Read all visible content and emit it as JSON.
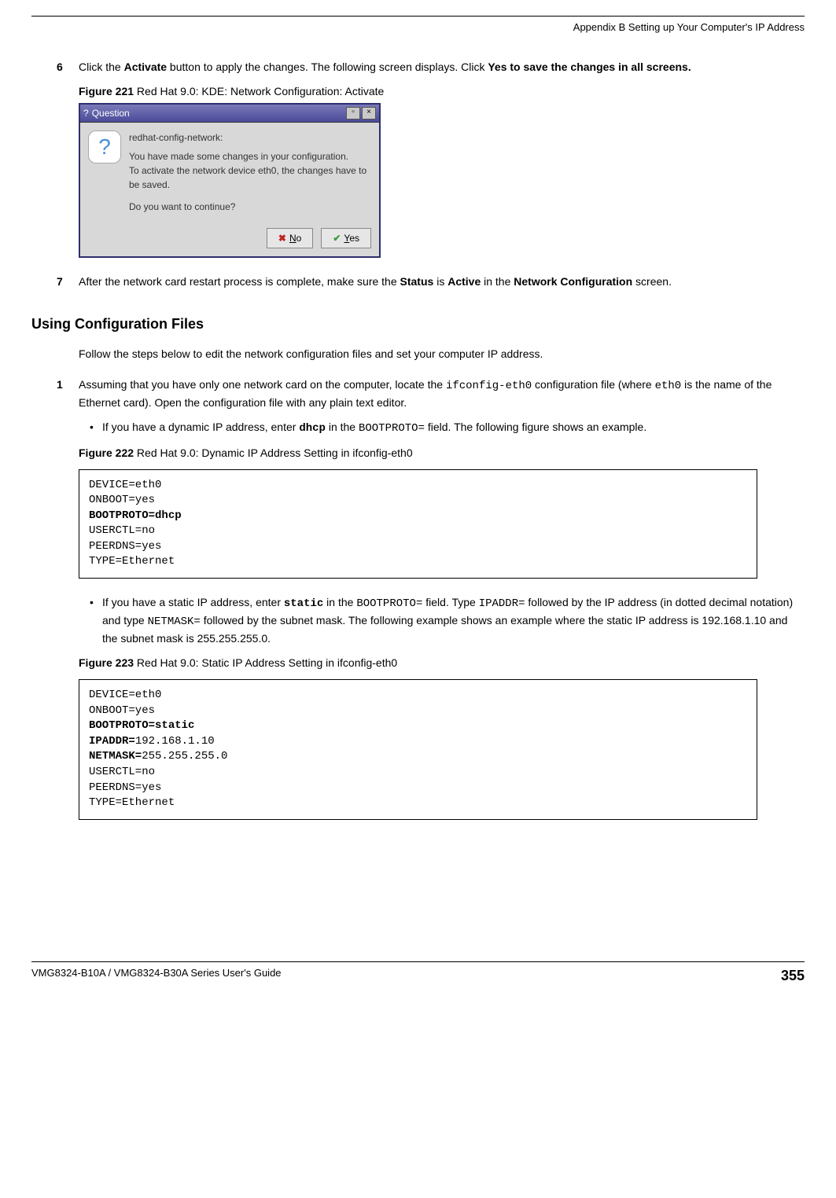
{
  "header": {
    "running_head": "Appendix B Setting up Your Computer's IP Address"
  },
  "step6": {
    "num": "6",
    "text_a": "Click the ",
    "text_bold1": "Activate",
    "text_b": " button to apply the changes. The following screen displays. Click ",
    "text_bold2": "Yes to save the changes in all screens."
  },
  "fig221": {
    "label": "Figure 221",
    "caption": "   Red Hat 9.0: KDE: Network Configuration: Activate"
  },
  "dialog": {
    "title": "Question",
    "app_name": "redhat-config-network:",
    "line1": "You have made some changes in your configuration.",
    "line2": "To activate the network device eth0, the changes have to be saved.",
    "line3": "Do you want to continue?",
    "btn_no": "No",
    "btn_yes": "Yes"
  },
  "step7": {
    "num": "7",
    "text_a": "After the network card restart process is complete, make sure the ",
    "text_bold1": "Status",
    "text_b": " is ",
    "text_bold2": "Active",
    "text_c": " in the ",
    "text_bold3": "Network Configuration",
    "text_d": " screen."
  },
  "section_title": "Using Configuration Files",
  "intro_para": "Follow the steps below to edit the network configuration files and set your computer IP address.",
  "step1": {
    "num": "1",
    "text_a": "Assuming that you have only one network card on the computer, locate the ",
    "mono1": "ifconfig-eth0",
    "text_b": " configuration file (where ",
    "mono2": "eth0",
    "text_c": " is the name of the Ethernet card). Open the configuration file with any plain text editor."
  },
  "bullet1": {
    "text_a": "If you have a dynamic IP address, enter ",
    "bmono1": "dhcp",
    "text_b": " in the ",
    "mono1": "BOOTPROTO=",
    "text_c": " field.  The following figure shows an example."
  },
  "fig222": {
    "label": "Figure 222",
    "caption": "   Red Hat 9.0: Dynamic IP Address Setting in ifconfig-eth0"
  },
  "code222": {
    "l1": "DEVICE=eth0",
    "l2": "ONBOOT=yes",
    "l3": "BOOTPROTO=dhcp",
    "l4": "USERCTL=no",
    "l5": "PEERDNS=yes",
    "l6": "TYPE=Ethernet"
  },
  "bullet2": {
    "text_a": "If you have a static IP address, enter ",
    "bmono1": "static",
    "text_b": " in the ",
    "mono1": "BOOTPROTO=",
    "text_c": " field. Type ",
    "mono2": "IPADDR=",
    "text_d": " followed by the IP address (in dotted decimal notation) and type ",
    "mono3": "NETMASK=",
    "text_e": " followed by the subnet mask. The following example shows an example where the static IP address is 192.168.1.10 and the subnet mask is 255.255.255.0."
  },
  "fig223": {
    "label": "Figure 223",
    "caption": "   Red Hat 9.0: Static IP Address Setting in ifconfig-eth0"
  },
  "code223": {
    "l1": "DEVICE=eth0",
    "l2": "ONBOOT=yes",
    "l3b_k": "BOOTPROTO=",
    "l3b_v": "static",
    "l4b_k": "IPADDR=",
    "l4b_v": "192.168.1.10",
    "l5b_k": "NETMASK=",
    "l5b_v": "255.255.255.0",
    "l6": "USERCTL=no",
    "l7": "PEERDNS=yes",
    "l8": "TYPE=Ethernet"
  },
  "footer": {
    "guide": "VMG8324-B10A / VMG8324-B30A Series User's Guide",
    "page": "355"
  }
}
